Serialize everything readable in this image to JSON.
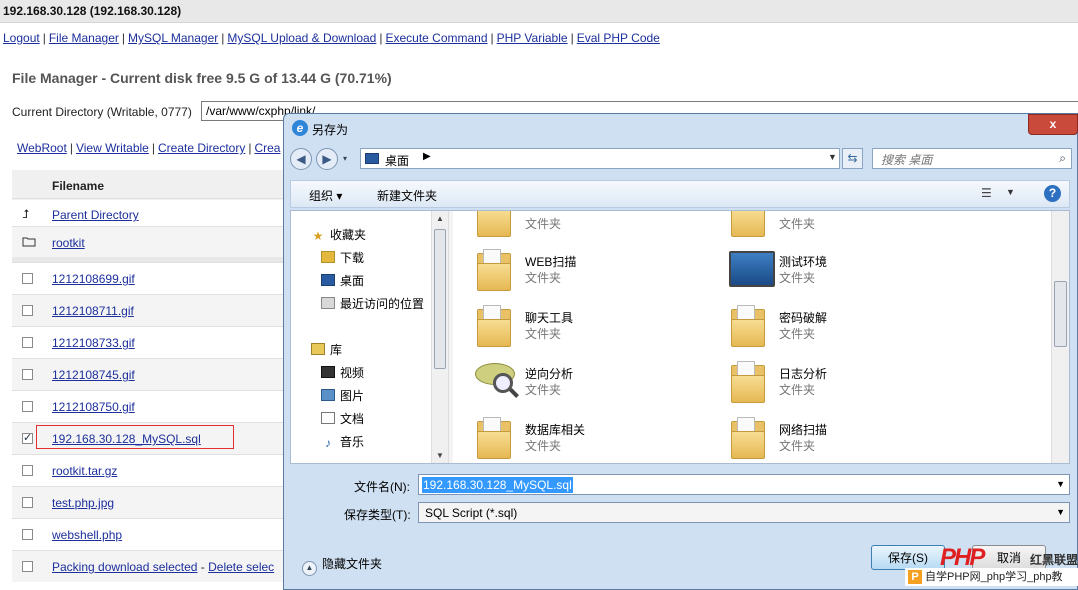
{
  "window": {
    "title": "192.168.30.128 (192.168.30.128)"
  },
  "nav": {
    "links": [
      "Logout",
      "File Manager",
      "MySQL Manager",
      "MySQL Upload & Download",
      "Execute Command",
      "PHP Variable",
      "Eval PHP Code"
    ],
    "separator": "|"
  },
  "file_manager": {
    "title": "File Manager - Current disk free 9.5 G of 13.44 G (70.71%)",
    "current_dir_label": "Current Directory (Writable, 0777)",
    "current_dir_value": "/var/www/cxphp/link/",
    "links": [
      "WebRoot",
      "View Writable",
      "Create Directory",
      "Crea"
    ],
    "column_filename": "Filename",
    "parent_directory": "Parent Directory",
    "folder": "rootkit",
    "files": [
      {
        "name": "1212108699.gif",
        "checked": false
      },
      {
        "name": "1212108711.gif",
        "checked": false
      },
      {
        "name": "1212108733.gif",
        "checked": false
      },
      {
        "name": "1212108745.gif",
        "checked": false
      },
      {
        "name": "1212108750.gif",
        "checked": false
      },
      {
        "name": "192.168.30.128_MySQL.sql",
        "checked": true
      },
      {
        "name": "rootkit.tar.gz",
        "checked": false
      },
      {
        "name": "test.php.jpg",
        "checked": false
      },
      {
        "name": "webshell.php",
        "checked": false
      }
    ],
    "footer_link1": "Packing download selected",
    "footer_sep": "-",
    "footer_link2": "Delete selec"
  },
  "dialog": {
    "title": "另存为",
    "close_label": "x",
    "address": "桌面",
    "search_placeholder": "搜索 桌面",
    "toolbar_organize": "组织 ▾",
    "toolbar_new_folder": "新建文件夹",
    "left_nav": {
      "favorites": "收藏夹",
      "downloads": "下载",
      "desktop": "桌面",
      "recent": "最近访问的位置",
      "libraries": "库",
      "videos": "视频",
      "pictures": "图片",
      "documents": "文档",
      "music": "音乐"
    },
    "items": [
      {
        "name": "",
        "type": "文件夹"
      },
      {
        "name": "",
        "type": "文件夹"
      },
      {
        "name": "WEB扫描",
        "type": "文件夹"
      },
      {
        "name": "测试环境",
        "type": "文件夹"
      },
      {
        "name": "聊天工具",
        "type": "文件夹"
      },
      {
        "name": "密码破解",
        "type": "文件夹"
      },
      {
        "name": "逆向分析",
        "type": "文件夹"
      },
      {
        "name": "日志分析",
        "type": "文件夹"
      },
      {
        "name": "数据库相关",
        "type": "文件夹"
      },
      {
        "name": "网络扫描",
        "type": "文件夹"
      }
    ],
    "filename_label": "文件名(N):",
    "filename_value": "192.168.30.128_MySQL.sql",
    "filetype_label": "保存类型(T):",
    "filetype_value": "SQL Script (*.sql)",
    "hide_folders": "隐藏文件夹",
    "save_button": "保存(S)",
    "cancel_button": "取消"
  },
  "watermark": {
    "logo": "PHP",
    "right": "红黑联盟",
    "bar": "自学PHP网_php学习_php教"
  }
}
